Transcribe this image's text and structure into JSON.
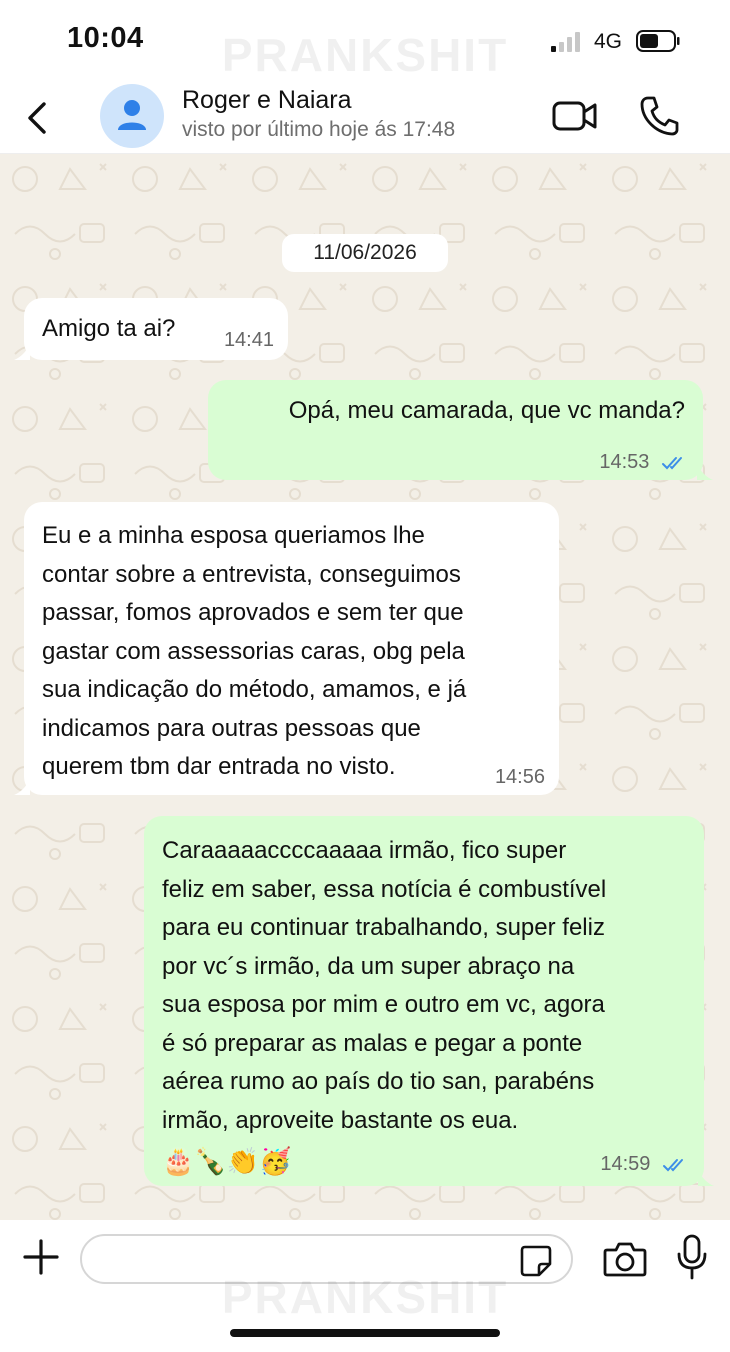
{
  "status_bar": {
    "time": "10:04",
    "network": "4G"
  },
  "watermark": "PRANKSHIT",
  "header": {
    "contact_name": "Roger e Naiara",
    "contact_status": "visto por último hoje ás 17:48",
    "icons": [
      "back-arrow-icon",
      "person-icon",
      "video-camera-icon",
      "phone-icon"
    ]
  },
  "chat": {
    "date": "11/06/2026",
    "messages": [
      {
        "direction": "in",
        "text": "Amigo ta ai?",
        "time": "14:41"
      },
      {
        "direction": "out",
        "text": "Opá, meu camarada, que vc manda?",
        "time": "14:53",
        "read": true
      },
      {
        "direction": "in",
        "lines": [
          "Eu e a minha esposa queriamos lhe",
          "contar sobre a entrevista, conseguimos",
          "passar, fomos aprovados e sem ter que",
          "gastar com assessorias caras, obg pela",
          "sua indicação do método, amamos, e já",
          "indicamos para outras pessoas que",
          "querem tbm dar entrada no visto."
        ],
        "time": "14:56"
      },
      {
        "direction": "out",
        "lines": [
          "Caraaaaaccccaaaaa irmão, fico super",
          "feliz em saber, essa notícia é combustível",
          "para eu continuar trabalhando, super feliz",
          "por vc´s irmão, da um super abraço na",
          "sua esposa por mim e outro em vc, agora",
          "é só preparar as malas e pegar a ponte",
          "aérea rumo ao país do tio san, parabéns",
          "irmão, aproveite bastante os eua."
        ],
        "emojis": "🎂🍾👏🥳",
        "time": "14:59",
        "read": true
      }
    ]
  },
  "input": {
    "placeholder": "",
    "icons": [
      "plus-icon",
      "sticker-icon",
      "camera-icon",
      "microphone-icon"
    ]
  },
  "colors": {
    "incoming_bubble": "#ffffff",
    "outgoing_bubble": "#d9fdd3",
    "chat_background": "#f3efe7",
    "read_ticks": "#3d8ee8",
    "avatar_bg": "#cfe4fb",
    "avatar_icon": "#2f80e8"
  }
}
